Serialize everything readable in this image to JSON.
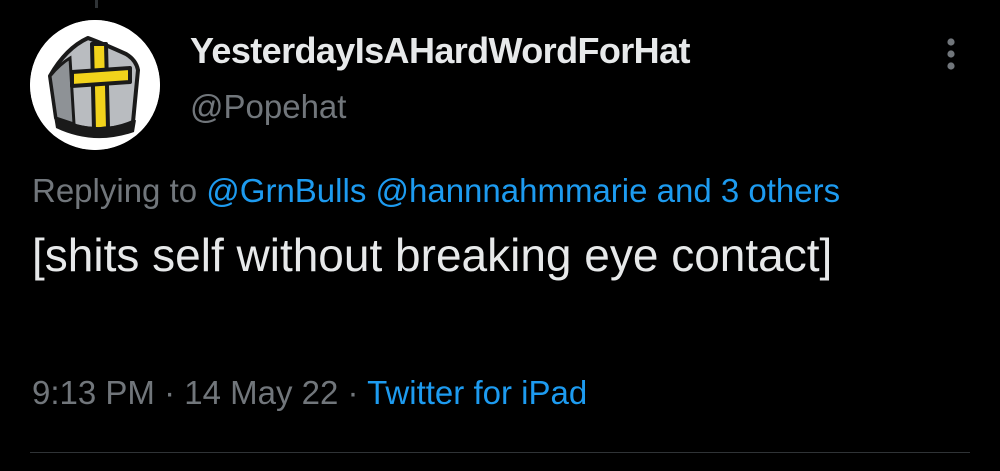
{
  "tweet": {
    "display_name": "YesterdayIsAHardWordForHat",
    "handle": "@Popehat",
    "replying_prefix": "Replying to",
    "reply_mentions": [
      "@GrnBulls",
      "@hannnahmmarie"
    ],
    "reply_and": "and",
    "reply_others": "3 others",
    "text": "[shits self without breaking eye contact]",
    "time": "9:13 PM",
    "date": "14 May 22",
    "separator": "·",
    "source": "Twitter for iPad"
  },
  "icons": {
    "avatar": "popehat-mitre-logo",
    "more": "vertical-ellipsis-icon"
  },
  "colors": {
    "background": "#000000",
    "primary_text": "#e7e9ea",
    "secondary_text": "#71767b",
    "link": "#1d9bf0",
    "mitre_yellow": "#f2d31b",
    "mitre_gray": "#b9bcc0"
  }
}
